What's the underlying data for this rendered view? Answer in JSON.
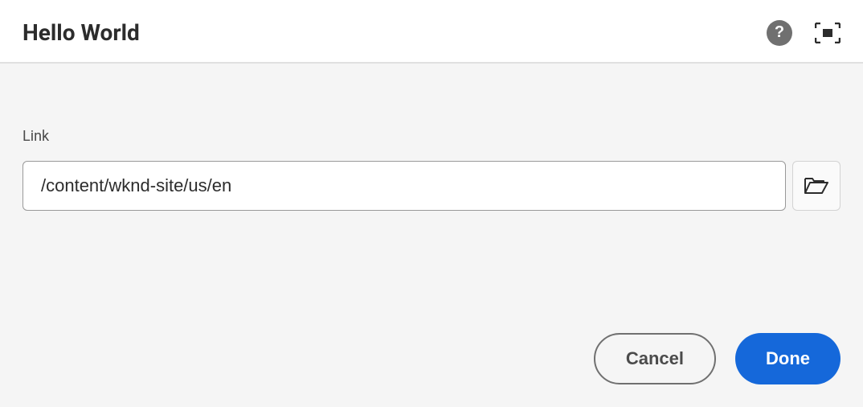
{
  "dialog": {
    "title": "Hello World",
    "header": {
      "help_glyph": "?"
    },
    "body": {
      "link_field": {
        "label": "Link",
        "value": "/content/wknd-site/us/en"
      }
    },
    "footer": {
      "cancel_label": "Cancel",
      "done_label": "Done"
    }
  }
}
